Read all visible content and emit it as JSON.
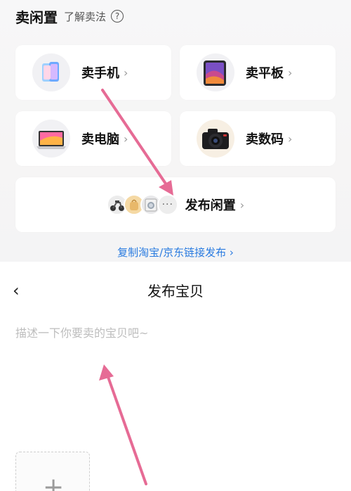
{
  "sell_section": {
    "title": "卖闲置",
    "learn_link": "了解卖法",
    "help_glyph": "?"
  },
  "categories": [
    {
      "label": "卖手机",
      "icon": "smartphone-icon"
    },
    {
      "label": "卖平板",
      "icon": "tablet-icon"
    },
    {
      "label": "卖电脑",
      "icon": "laptop-icon"
    },
    {
      "label": "卖数码",
      "icon": "camera-icon"
    }
  ],
  "publish_idle": {
    "label": "发布闲置",
    "more_glyph": "···"
  },
  "chevron": "›",
  "copy_link": "复制淘宝/京东链接发布 ›",
  "publish_page": {
    "back_glyph": "‹",
    "title": "发布宝贝",
    "description_placeholder": "描述一下你要卖的宝贝吧~",
    "description_value": "",
    "add_photo_glyph": "+"
  },
  "colors": {
    "accent_link": "#2a7be0",
    "annotation_arrow": "#e66b95"
  }
}
